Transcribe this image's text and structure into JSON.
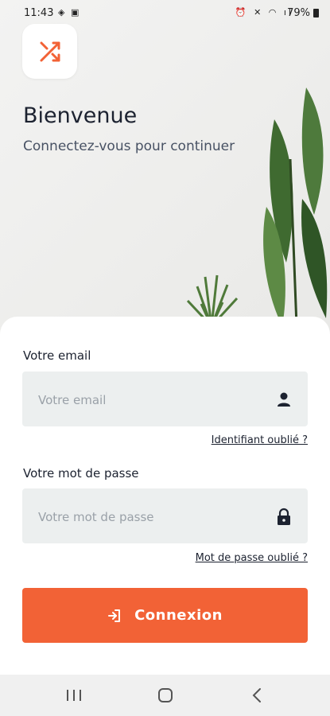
{
  "status_bar": {
    "time": "11:43",
    "battery": "79%"
  },
  "header": {
    "title": "Bienvenue",
    "subtitle": "Connectez-vous pour continuer"
  },
  "form": {
    "email_label": "Votre email",
    "email_placeholder": "Votre email",
    "email_value": "",
    "forgot_id_link": "Identifiant oublié ?",
    "password_label": "Votre mot de passe",
    "password_placeholder": "Votre mot de passe",
    "password_value": "",
    "forgot_password_link": "Mot de passe oublié ?",
    "submit_label": "Connexion"
  },
  "colors": {
    "accent": "#f26236",
    "text": "#1c2230",
    "field_bg": "#ecefef"
  },
  "icons": {
    "logo": "shuffle-icon",
    "email_field": "user-icon",
    "password_field": "lock-icon",
    "submit": "login-icon",
    "nav_recent": "recent-apps-icon",
    "nav_home": "home-icon",
    "nav_back": "back-icon"
  }
}
